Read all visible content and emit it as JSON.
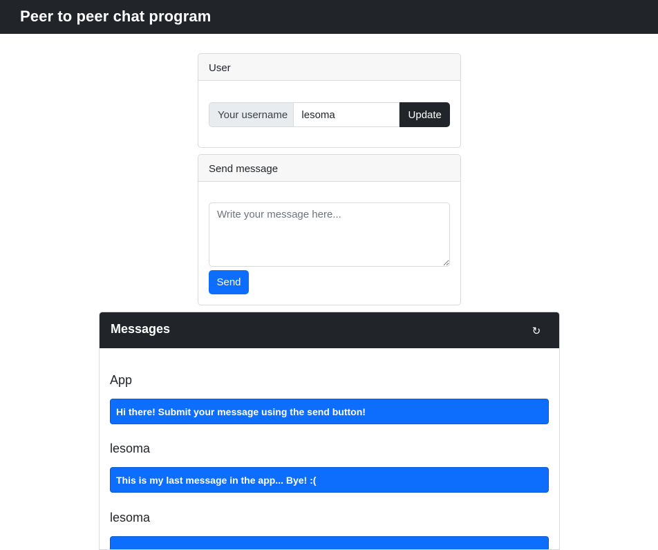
{
  "header": {
    "title": "Peer to peer chat program"
  },
  "user_card": {
    "title": "User",
    "username_label": "Your username",
    "username_value": "lesoma",
    "update_label": "Update"
  },
  "send_card": {
    "title": "Send message",
    "placeholder": "Write your message here...",
    "send_label": "Send"
  },
  "messages": {
    "title": "Messages",
    "refresh_icon": "↻",
    "items": [
      {
        "user": "App",
        "text": "Hi there! Submit your message using the send button!"
      },
      {
        "user": "lesoma",
        "text": "This is my last message in the app... Bye! :("
      },
      {
        "user": "lesoma",
        "text": ""
      }
    ]
  }
}
